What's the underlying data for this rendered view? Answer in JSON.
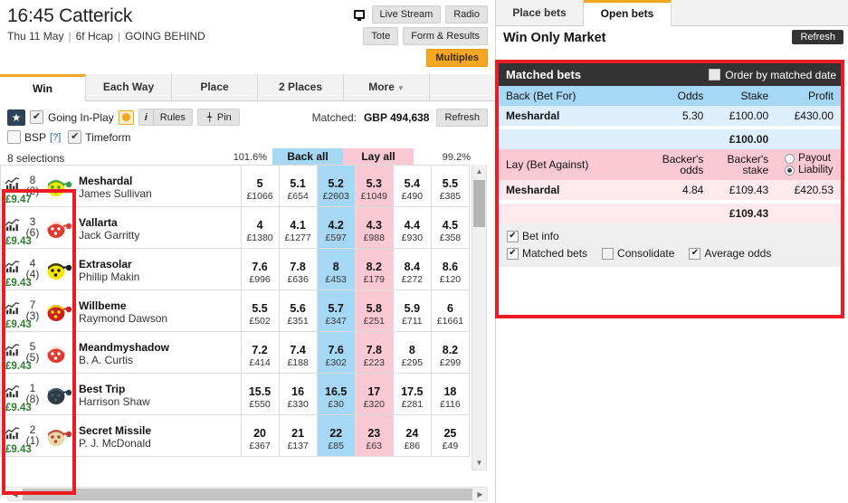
{
  "race": {
    "title": "16:45 Catterick",
    "date": "Thu 11 May",
    "distance": "6f Hcap",
    "status": "GOING BEHIND",
    "live_stream_label": "Live Stream",
    "radio_label": "Radio",
    "tote_label": "Tote",
    "form_results_label": "Form & Results",
    "multiples_label": "Multiples"
  },
  "tabs": [
    {
      "label": "Win",
      "active": true
    },
    {
      "label": "Each Way",
      "active": false
    },
    {
      "label": "Place",
      "active": false
    },
    {
      "label": "2 Places",
      "active": false
    },
    {
      "label": "More",
      "active": false,
      "caret": "▼"
    }
  ],
  "controls": {
    "star": "★",
    "going_inplay_check": "✔",
    "going_inplay_label": "Going In-Play",
    "rules_i": "i",
    "rules_label": "Rules",
    "pin_label": "Pin",
    "pin_icon": "📌",
    "bsp_label": "BSP",
    "bsp_help": "[?]",
    "timeform_label": "Timeform",
    "timeform_check": "✔",
    "matched_label": "Matched:",
    "matched_value": "GBP 494,638",
    "refresh_label": "Refresh"
  },
  "market": {
    "selections_label": "8 selections",
    "back_pct": "101.6%",
    "lay_pct": "99.2%",
    "back_all_label": "Back all",
    "lay_all_label": "Lay all",
    "runners": [
      {
        "saddle": "8",
        "draw": "(2)",
        "sp": "£9.47",
        "horse": "Meshardal",
        "jockey": "James Sullivan",
        "silk_body": "#f3e600",
        "silk_spots": "#2e9e4b",
        "silk_cap": "#2e9e4b",
        "prices": [
          {
            "odds": "5",
            "stake": "£1066"
          },
          {
            "odds": "5.1",
            "stake": "£654"
          },
          {
            "odds": "5.2",
            "stake": "£2603"
          },
          {
            "odds": "5.3",
            "stake": "£1049"
          },
          {
            "odds": "5.4",
            "stake": "£490"
          },
          {
            "odds": "5.5",
            "stake": "£385"
          }
        ]
      },
      {
        "saddle": "3",
        "draw": "(6)",
        "sp": "£9.43",
        "horse": "Vallarta",
        "jockey": "Jack Garritty",
        "silk_body": "#e03b2f",
        "silk_spots": "#ffffff",
        "silk_cap": "#e03b2f",
        "prices": [
          {
            "odds": "4",
            "stake": "£1380"
          },
          {
            "odds": "4.1",
            "stake": "£1277"
          },
          {
            "odds": "4.2",
            "stake": "£597"
          },
          {
            "odds": "4.3",
            "stake": "£988"
          },
          {
            "odds": "4.4",
            "stake": "£930"
          },
          {
            "odds": "4.5",
            "stake": "£358"
          }
        ]
      },
      {
        "saddle": "4",
        "draw": "(4)",
        "sp": "£9.43",
        "horse": "Extrasolar",
        "jockey": "Phillip Makin",
        "silk_body": "#f3e600",
        "silk_spots": "#1a1a1a",
        "silk_cap": "#1a1a1a",
        "prices": [
          {
            "odds": "7.6",
            "stake": "£996"
          },
          {
            "odds": "7.8",
            "stake": "£636"
          },
          {
            "odds": "8",
            "stake": "£453"
          },
          {
            "odds": "8.2",
            "stake": "£179"
          },
          {
            "odds": "8.4",
            "stake": "£272"
          },
          {
            "odds": "8.6",
            "stake": "£120"
          }
        ]
      },
      {
        "saddle": "7",
        "draw": "(3)",
        "sp": "£9.43",
        "horse": "Willbeme",
        "jockey": "Raymond Dawson",
        "silk_body": "#cc1f1f",
        "silk_spots": "#f3e600",
        "silk_cap": "#cc1f1f",
        "prices": [
          {
            "odds": "5.5",
            "stake": "£502"
          },
          {
            "odds": "5.6",
            "stake": "£351"
          },
          {
            "odds": "5.7",
            "stake": "£347"
          },
          {
            "odds": "5.8",
            "stake": "£251"
          },
          {
            "odds": "5.9",
            "stake": "£711"
          },
          {
            "odds": "6",
            "stake": "£1661"
          }
        ]
      },
      {
        "saddle": "5",
        "draw": "(5)",
        "sp": "£9.43",
        "horse": "Meandmyshadow",
        "jockey": "B. A. Curtis",
        "silk_body": "#e03b2f",
        "silk_spots": "#ffffff",
        "silk_cap": "#ffffff",
        "prices": [
          {
            "odds": "7.2",
            "stake": "£414"
          },
          {
            "odds": "7.4",
            "stake": "£188"
          },
          {
            "odds": "7.6",
            "stake": "£302"
          },
          {
            "odds": "7.8",
            "stake": "£223"
          },
          {
            "odds": "8",
            "stake": "£295"
          },
          {
            "odds": "8.2",
            "stake": "£299"
          }
        ]
      },
      {
        "saddle": "1",
        "draw": "(8)",
        "sp": "£9.43",
        "horse": "Best Trip",
        "jockey": "Harrison Shaw",
        "silk_body": "#2b3a44",
        "silk_spots": "#4a5a66",
        "silk_cap": "#2b3a44",
        "prices": [
          {
            "odds": "15.5",
            "stake": "£550"
          },
          {
            "odds": "16",
            "stake": "£330"
          },
          {
            "odds": "16.5",
            "stake": "£30"
          },
          {
            "odds": "17",
            "stake": "£320"
          },
          {
            "odds": "17.5",
            "stake": "£281"
          },
          {
            "odds": "18",
            "stake": "£116"
          }
        ]
      },
      {
        "saddle": "2",
        "draw": "(1)",
        "sp": "£9.43",
        "horse": "Secret Missile",
        "jockey": "P. J. McDonald",
        "silk_body": "#e8d9a8",
        "silk_spots": "#c23b2a",
        "silk_cap": "#c23b2a",
        "prices": [
          {
            "odds": "20",
            "stake": "£367"
          },
          {
            "odds": "21",
            "stake": "£137"
          },
          {
            "odds": "22",
            "stake": "£85"
          },
          {
            "odds": "23",
            "stake": "£63"
          },
          {
            "odds": "24",
            "stake": "£86"
          },
          {
            "odds": "25",
            "stake": "£49"
          }
        ]
      }
    ]
  },
  "bets_panel": {
    "tabs": [
      {
        "label": "Place bets",
        "active": false
      },
      {
        "label": "Open bets",
        "active": true
      }
    ],
    "market_name": "Win Only Market",
    "refresh_label": "Refresh",
    "matched_bets_title": "Matched bets",
    "order_by_matched_date_label": "Order by matched date",
    "back": {
      "header": "Back (Bet For)",
      "col_odds": "Odds",
      "col_stake": "Stake",
      "col_profit": "Profit",
      "rows": [
        {
          "name": "Meshardal",
          "odds": "5.30",
          "stake": "£100.00",
          "profit": "£430.00"
        }
      ],
      "total": "£100.00"
    },
    "lay": {
      "header": "Lay (Bet Against)",
      "col_odds_l1": "Backer's",
      "col_odds_l2": "odds",
      "col_stake_l1": "Backer's",
      "col_stake_l2": "stake",
      "payout_label": "Payout",
      "liability_label": "Liability",
      "rows": [
        {
          "name": "Meshardal",
          "odds": "4.84",
          "stake": "£109.43",
          "profit": "£420.53"
        }
      ],
      "total": "£109.43"
    },
    "options": {
      "bet_info": "Bet info",
      "matched_bets": "Matched bets",
      "consolidate": "Consolidate",
      "average_odds": "Average odds"
    }
  },
  "colors": {
    "accent": "#f5a623",
    "back_blue": "#a6d8f5",
    "lay_pink": "#fac9d3",
    "annotation_red": "#ed1c24",
    "dark_header": "#333333",
    "sp_green": "#2e7d32"
  }
}
